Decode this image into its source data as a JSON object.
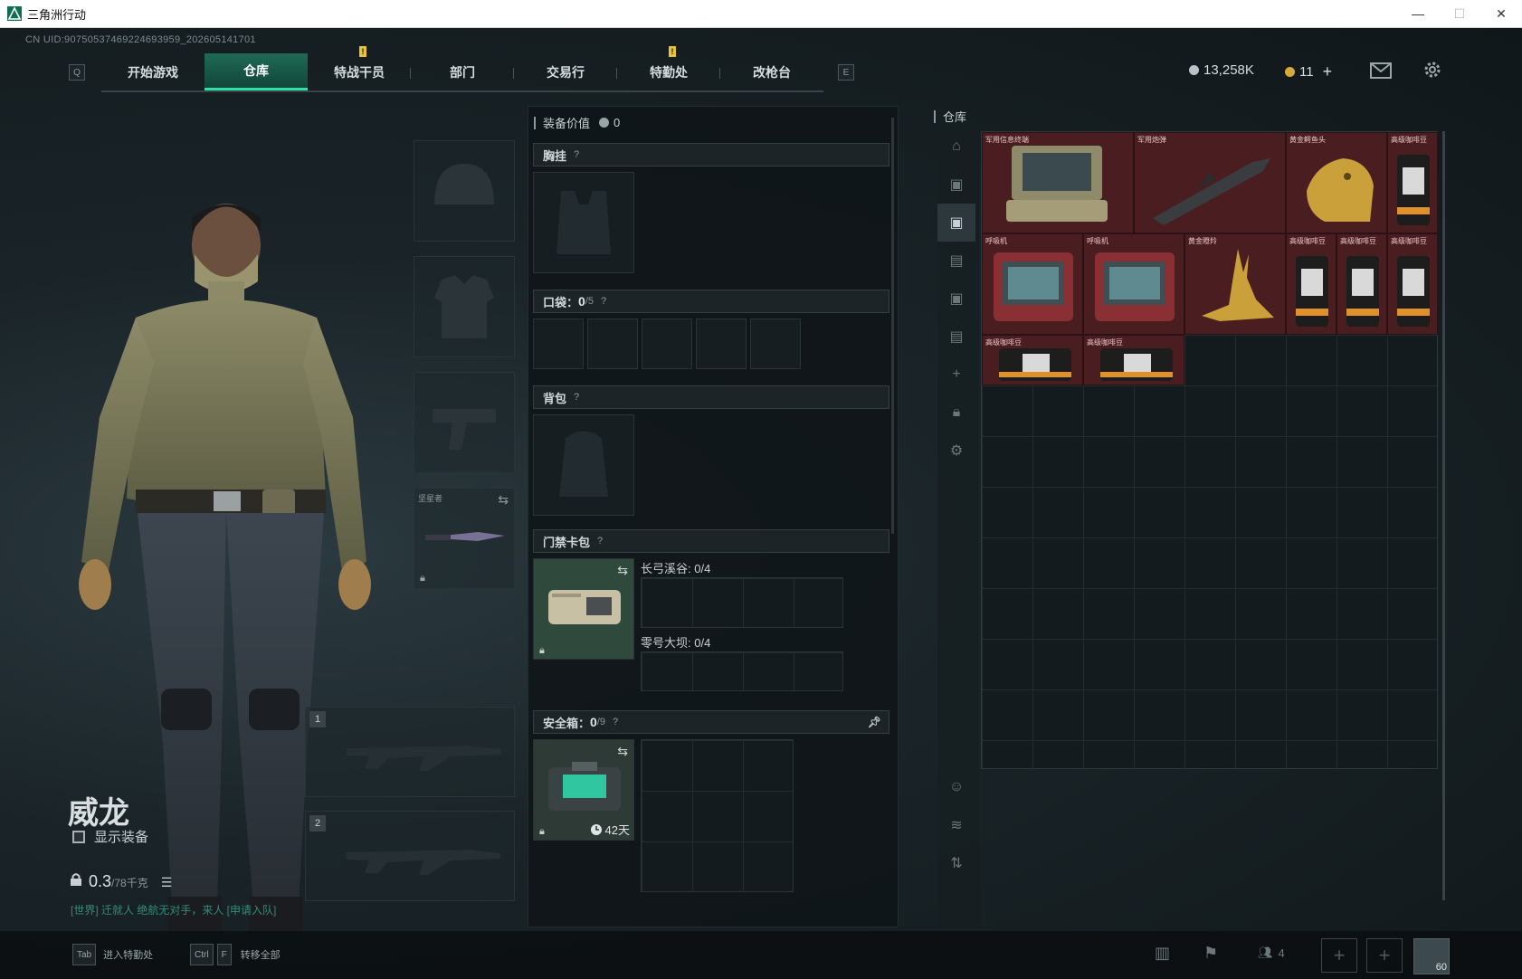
{
  "window": {
    "title": "三角洲行动",
    "min": "—",
    "max": "☐",
    "close": "✕"
  },
  "uid": "CN UID:9075053746922469395​9_202605141701",
  "nav": {
    "left_key": "Q",
    "right_key": "E",
    "tabs": [
      {
        "label": "开始游戏"
      },
      {
        "label": "仓库"
      },
      {
        "label": "特战干员"
      },
      {
        "label": "部门"
      },
      {
        "label": "交易行"
      },
      {
        "label": "特勤处"
      },
      {
        "label": "改枪台"
      }
    ]
  },
  "currency": {
    "coins": "13,258K",
    "tickets": "11",
    "plus": "+"
  },
  "character": {
    "name": "威龙",
    "show_equipment": "显示装备",
    "weight": "0.3",
    "weight_max": "/78千克",
    "chat": "[世界] 迁就人 绝航无对手，来人 [申请入队]"
  },
  "weapon_slots": [
    {
      "num": "1"
    },
    {
      "num": "2"
    }
  ],
  "melee_slot": {
    "name": "坚星者"
  },
  "loadout": {
    "value_label": "装备价值",
    "value": "0",
    "chest_rig": "胸挂",
    "pockets": "口袋：",
    "pockets_count": "0",
    "pockets_max": "/5",
    "backpack": "背包",
    "keycard": "门禁卡包",
    "key_a": "长弓溪谷: 0/4",
    "key_b": "零号大坝: 0/4",
    "safe": "安全箱：",
    "safe_count": "0",
    "safe_max": "/9",
    "safe_days": "42天",
    "help": "?"
  },
  "warehouse": {
    "title": "仓库",
    "items": [
      {
        "name": "军用信息终端"
      },
      {
        "name": "军用炮弹"
      },
      {
        "name": "黄金鳄鱼头"
      },
      {
        "name": "高级咖啡豆"
      },
      {
        "name": "呼吸机"
      },
      {
        "name": "呼吸机"
      },
      {
        "name": "黄金瞪羚"
      },
      {
        "name": "高级咖啡豆"
      },
      {
        "name": "高级咖啡豆"
      },
      {
        "name": "高级咖啡豆"
      },
      {
        "name": "高级咖啡豆"
      },
      {
        "name": "高级咖啡豆"
      }
    ]
  },
  "bottom": {
    "tab_key": "Tab",
    "tab_label": "进入特勤处",
    "ctrl_key": "Ctrl",
    "f_key": "F",
    "f_label": "转移全部",
    "friends_count": "4",
    "level": "60"
  }
}
